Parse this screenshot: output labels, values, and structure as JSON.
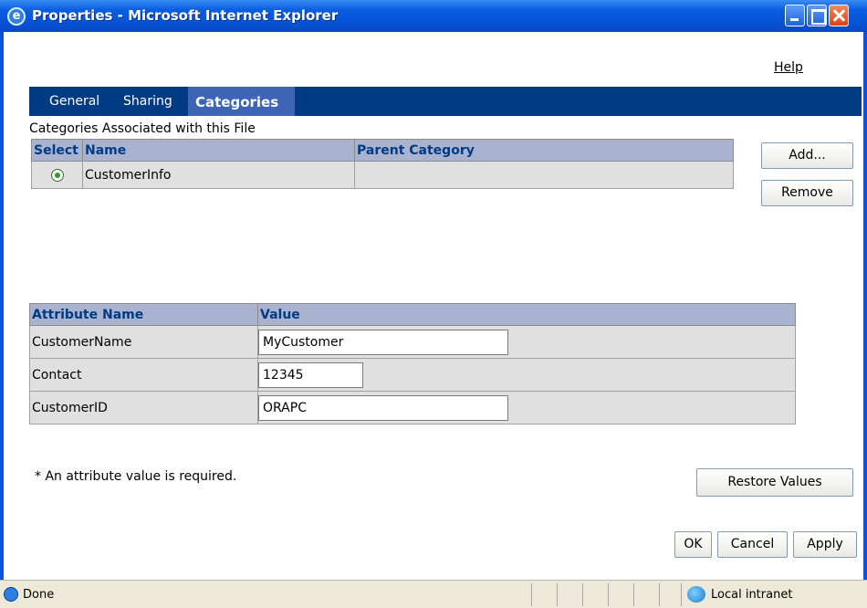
{
  "window": {
    "title": "Properties - Microsoft Internet Explorer"
  },
  "help_label": "Help",
  "tabs": [
    {
      "label": "General",
      "active": false
    },
    {
      "label": "Sharing",
      "active": false
    },
    {
      "label": "Categories",
      "active": true
    }
  ],
  "categories": {
    "caption": "Categories Associated with this File",
    "headers": {
      "select": "Select",
      "name": "Name",
      "parent": "Parent Category"
    },
    "rows": [
      {
        "selected": true,
        "name": "CustomerInfo",
        "parent": ""
      }
    ],
    "add_label": "Add...",
    "remove_label": "Remove"
  },
  "attributes": {
    "headers": {
      "name": "Attribute Name",
      "value": "Value"
    },
    "rows": [
      {
        "name": "CustomerName",
        "value": "MyCustomer"
      },
      {
        "name": "Contact",
        "value": "12345"
      },
      {
        "name": "CustomerID",
        "value": "ORAPC"
      }
    ]
  },
  "required_note": "* An attribute value is required.",
  "buttons": {
    "restore": "Restore Values",
    "ok": "OK",
    "cancel": "Cancel",
    "apply": "Apply"
  },
  "statusbar": {
    "status": "Done",
    "zone": "Local intranet"
  },
  "colors": {
    "tabbar": "#003b83",
    "active_tab": "#3d64b5",
    "table_header": "#a9b3d0",
    "titlebar": "#0a5fdf"
  }
}
